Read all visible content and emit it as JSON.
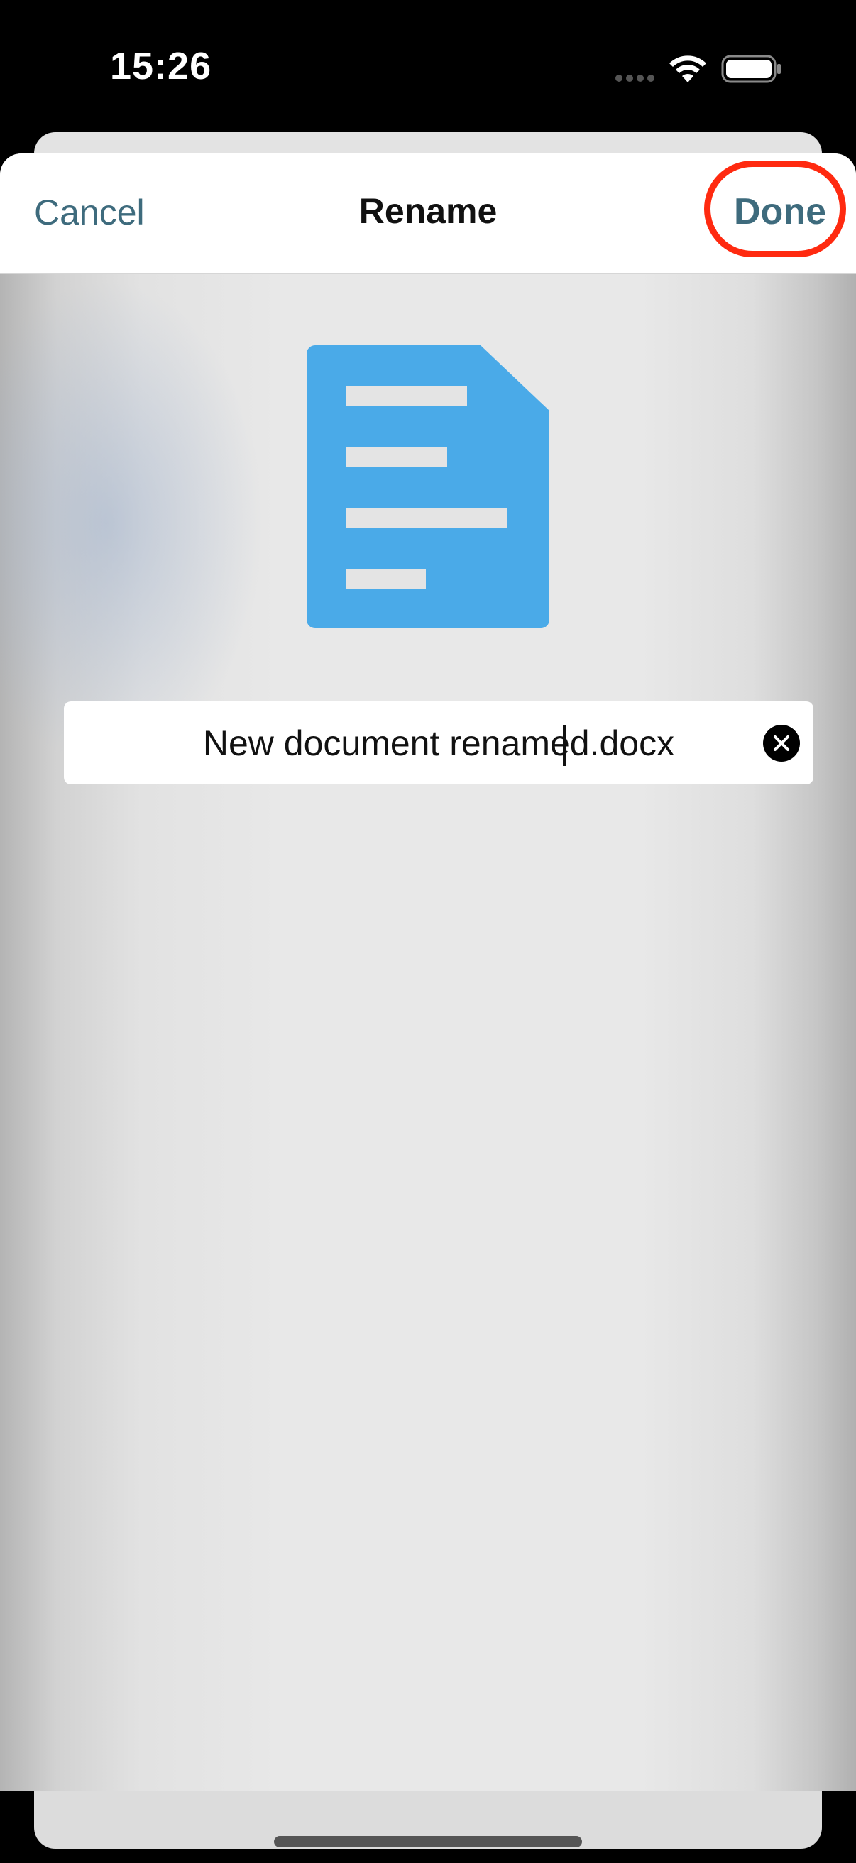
{
  "status_bar": {
    "time": "15:26"
  },
  "nav": {
    "cancel_label": "Cancel",
    "title": "Rename",
    "done_label": "Done"
  },
  "file": {
    "name_value": "New document renamed.docx",
    "icon": "document-icon"
  },
  "colors": {
    "accent": "#3e6b7d",
    "document_icon": "#4aaae8",
    "highlight": "#ff2a10"
  }
}
